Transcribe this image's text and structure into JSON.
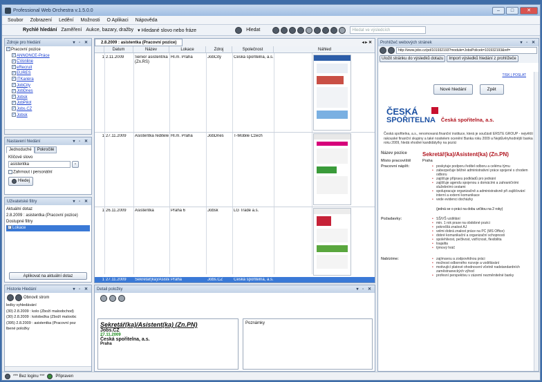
{
  "window": {
    "title": "Professional Web Orchestra v.1.5.0.0"
  },
  "menu": [
    "Soubor",
    "Zobrazení",
    "Ledění",
    "Možnosti",
    "O Aplikaci",
    "Nápověda"
  ],
  "toolbar": {
    "quick_search_label": "Rychlé hledání",
    "zamereni_label": "Zaměření",
    "zamereni_value": "Aukce, bazary, dražby",
    "keyword_placeholder": "Hledané slovo nebo fráze",
    "search_button": "Hledat",
    "search_in_results": "Hledat ve výsledcích"
  },
  "sources_panel": {
    "title": "Zdroje pro hledání",
    "root": "Pracovní pozice",
    "items": [
      "ANNONCE-Práce",
      "CVonline",
      "eRecruit",
      "EURES",
      "ITKariéra",
      "JobCity",
      "JobDnes",
      "Jobsk",
      "JobPilot",
      "Jobs.CZ",
      "Jobsk"
    ]
  },
  "search_settings_panel": {
    "title": "Nastavení hledání",
    "tabs": [
      "Jednoduché",
      "Pokročilé"
    ],
    "keyword_label": "Klíčové slovo",
    "keyword_value": "asistentka",
    "include_personal": "Zahrnout i personální",
    "search_button": "Hledej"
  },
  "user_filters_panel": {
    "title": "Uživatelské filtry",
    "current_query_label": "Aktuální dotaz",
    "current_query_value": "2.8.2009 : asistentka (Pracovní pozice)",
    "available_filters_label": "Dostupné filtry",
    "filter_item": "Lokace",
    "apply_button": "Aplikovat na aktuální dotaz"
  },
  "history_panel": {
    "title": "Historie Hledání",
    "refresh_label": "Obnovit strom",
    "items": [
      "ledky vyhledávání",
      "(30) 2.8.2009 : kolo (Zboží maloobchod)",
      "(30) 2.8.2009 : kolobežka (Zboží maloobc",
      "(395) 2.8.2009 : asistentka (Pracovní poz",
      "lbené položky"
    ]
  },
  "results_panel": {
    "tab_title": "2.8.2009 : asistentka (Pracovní pozice)",
    "columns": [
      "",
      "Datum",
      "Název",
      "Lokace",
      "Zdroj",
      "Společnost",
      "Náhled"
    ],
    "rows": [
      {
        "n": "1",
        "date": "2.11.2009",
        "name": "Senior asistent/ka (Zn.RS)",
        "location": "Hl.m. Praha",
        "source": "JobCity",
        "company": "Česká spořitelna, a.s."
      },
      {
        "n": "1",
        "date": "27.11.2009",
        "name": "Asistentka ředitele",
        "location": "Hl.m. Praha",
        "source": "JobDnes",
        "company": "T-Mobile Czech"
      },
      {
        "n": "1",
        "date": "26.11.2009",
        "name": "Asistentka",
        "location": "Praha 6",
        "source": "Jobsk",
        "company": "LG Trade a.s."
      },
      {
        "n": "1",
        "date": "27.11.2009",
        "name": "Sekretář(ka)/Asistent(ka) (Zn.PN)",
        "location": "Praha",
        "source": "Jobs.CZ",
        "company": "Česká spořitelna, a.s."
      }
    ]
  },
  "detail_panel": {
    "title": "Detail položky",
    "job_title": "Sekretář(ka)/Asistent(ka) (Zn.PN)",
    "source": "Jobs.CZ",
    "date": "27.11.2009",
    "company": "Česká spořitelna, a.s.",
    "location": "Praha",
    "notes_label": "Poznámky"
  },
  "browser_panel": {
    "title": "Prohlížeč webových stránek",
    "url": "http://www.jobs.cz/pd/101932193?module=JobsPolicek=101932193&ref=",
    "save_button": "Uložit stránku do výsledků dotazu",
    "import_button": "Import výsledků hledání z prohlížeče",
    "top_links": "TISK | POSLAT",
    "new_search": "Nové hledání",
    "back": "Zpět",
    "logo_line1": "ČESKÁ",
    "logo_line2": "SPOŘITELNA",
    "company_name": "Česká spořitelna, a.s.",
    "intro": "Česká spořitelna, a.s., renomovaná finanční instituce, která je součástí ERSTE GROUP - největší rakouské finanční skupiny a také nositelem ocenění Banka roku 2009 a Nejdůvěryhodnější banka roku 2009, hledá vhodné kandidáty/ky na pozici",
    "position_label": "Název pozice",
    "position_value": "Sekretář(ka)/Asistent(ka) (Zn.PN)",
    "place_label": "Místo pracoviště",
    "place_value": "Praha",
    "duties_label": "Pracovní náplň:",
    "duties": [
      "poskytuje podporu ředitel odboru a celému týmu",
      "zabezpečuje běžné administrativní práce spojené s chodem odboru",
      "zajišťuje přípravu podkladů pro jednání",
      "zajišťuje agendu spojenou s domácími a zahraničními služebními cestami",
      "spolupracuje organizačně a administrativně při zajišťování interní a externí komunikace",
      "vede evidenci docházky"
    ],
    "term_note": "(jedná se o práci na dobu určitou na 2 roky)",
    "requirements_label": "Požadavky:",
    "requirements": [
      "SŠ/VŠ vzdělání",
      "min. 1 rok praxe na obdobné pozici",
      "pokročilá znalost AJ",
      "velmi dobrá znalost práce na PC (MS Office)",
      "dobré komunikační a organizační schopnosti",
      "spolehlivost, pečlivost, vstřícnost, flexibilita",
      "loajalita",
      "týmový hráč"
    ],
    "offer_label": "Nabízíme:",
    "offer": [
      "zajímavou a zodpovědnou práci",
      "možnost odborného rozvoje a vzdělávání",
      "motivující platové ohodnocení včetně nadstandardních zaměstnaneckých výhod",
      "profesní perspektivu v zázemí nezměnitelné banky"
    ]
  },
  "status": {
    "login": "*** Bez loginu ***",
    "ready": "Připraven"
  }
}
